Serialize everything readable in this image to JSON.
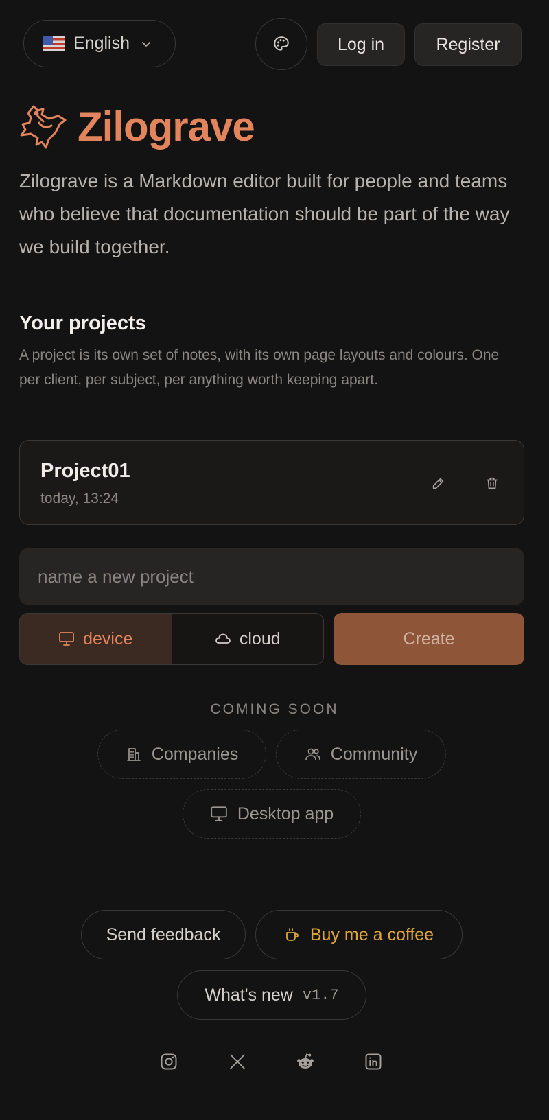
{
  "header": {
    "language": {
      "label": "English",
      "flag_icon": "us-flag-icon"
    },
    "theme_button_icon": "palette-icon",
    "login_label": "Log in",
    "register_label": "Register"
  },
  "brand": {
    "name": "Zilograve",
    "logo_icon": "bird-logo-icon",
    "color": "#e2845c",
    "tagline": "Zilograve is a Markdown editor built for people and teams who believe that documentation should be part of the way we build together."
  },
  "projects": {
    "title": "Your projects",
    "description": "A project is its own set of notes, with its own page layouts and colours. One per client, per subject, per anything worth keeping apart.",
    "items": [
      {
        "name": "Project01",
        "date": "today, 13:24"
      }
    ],
    "new_project": {
      "placeholder": "name a new project",
      "value": ""
    },
    "storage_options": [
      {
        "label": "device",
        "icon": "monitor-icon",
        "selected": true
      },
      {
        "label": "cloud",
        "icon": "cloud-icon",
        "selected": false
      }
    ],
    "create_label": "Create"
  },
  "coming_soon": {
    "label": "COMING SOON",
    "items": [
      {
        "label": "Companies",
        "icon": "building-icon"
      },
      {
        "label": "Community",
        "icon": "users-icon"
      },
      {
        "label": "Desktop app",
        "icon": "monitor-icon"
      }
    ]
  },
  "footer": {
    "feedback_label": "Send feedback",
    "coffee_label": "Buy me a coffee",
    "coffee_color": "#e0a63a",
    "whats_new_label": "What's new",
    "version": "v1.7",
    "social": [
      "instagram-icon",
      "x-icon",
      "reddit-icon",
      "linkedin-icon"
    ]
  }
}
